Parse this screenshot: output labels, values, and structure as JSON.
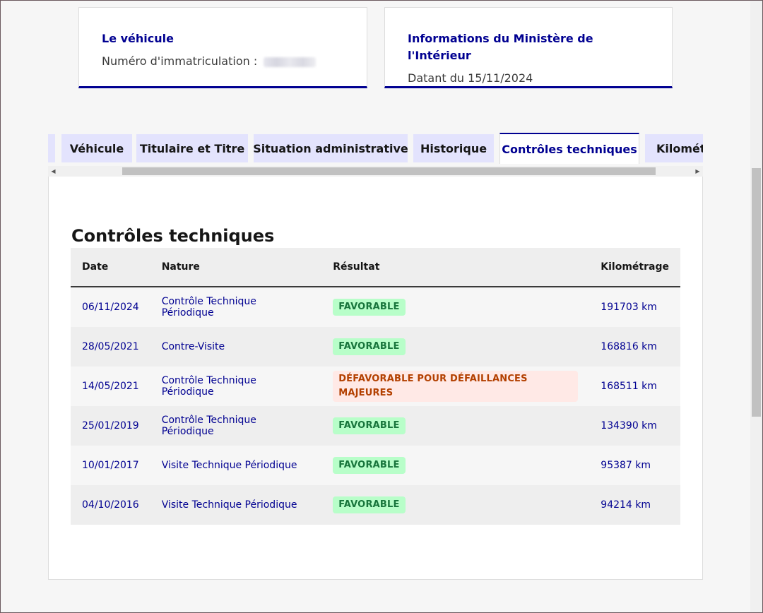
{
  "cards": {
    "vehicle": {
      "title": "Le véhicule",
      "plate_label": "Numéro d'immatriculation :"
    },
    "ministry": {
      "title": "Informations du Ministère de l'Intérieur",
      "date_text": "Datant du 15/11/2024"
    }
  },
  "tabs": [
    {
      "label": "Véhicule"
    },
    {
      "label": "Titulaire et Titre"
    },
    {
      "label": "Situation administrative"
    },
    {
      "label": "Historique"
    },
    {
      "label": "Contrôles techniques",
      "active": true
    },
    {
      "label": "Kilométr"
    }
  ],
  "section": {
    "title": "Contrôles techniques",
    "columns": [
      "Date",
      "Nature",
      "Résultat",
      "Kilométrage"
    ],
    "rows": [
      {
        "date": "06/11/2024",
        "nature": "Contrôle Technique Périodique",
        "result": "FAVORABLE",
        "status": "ok",
        "km": "191703 km"
      },
      {
        "date": "28/05/2021",
        "nature": "Contre-Visite",
        "result": "FAVORABLE",
        "status": "ok",
        "km": "168816 km"
      },
      {
        "date": "14/05/2021",
        "nature": "Contrôle Technique Périodique",
        "result": "DÉFAVORABLE POUR DÉFAILLANCES MAJEURES",
        "status": "ko",
        "km": "168511 km"
      },
      {
        "date": "25/01/2019",
        "nature": "Contrôle Technique Périodique",
        "result": "FAVORABLE",
        "status": "ok",
        "km": "134390 km"
      },
      {
        "date": "10/01/2017",
        "nature": "Visite Technique Périodique",
        "result": "FAVORABLE",
        "status": "ok",
        "km": "95387 km"
      },
      {
        "date": "04/10/2016",
        "nature": "Visite Technique Périodique",
        "result": "FAVORABLE",
        "status": "ok",
        "km": "94214 km"
      }
    ]
  },
  "colors": {
    "accent": "#000091",
    "favorable_bg": "#b8fec9",
    "favorable_text": "#18753c",
    "unfavorable_bg": "#ffe9e6",
    "unfavorable_text": "#b34000"
  }
}
